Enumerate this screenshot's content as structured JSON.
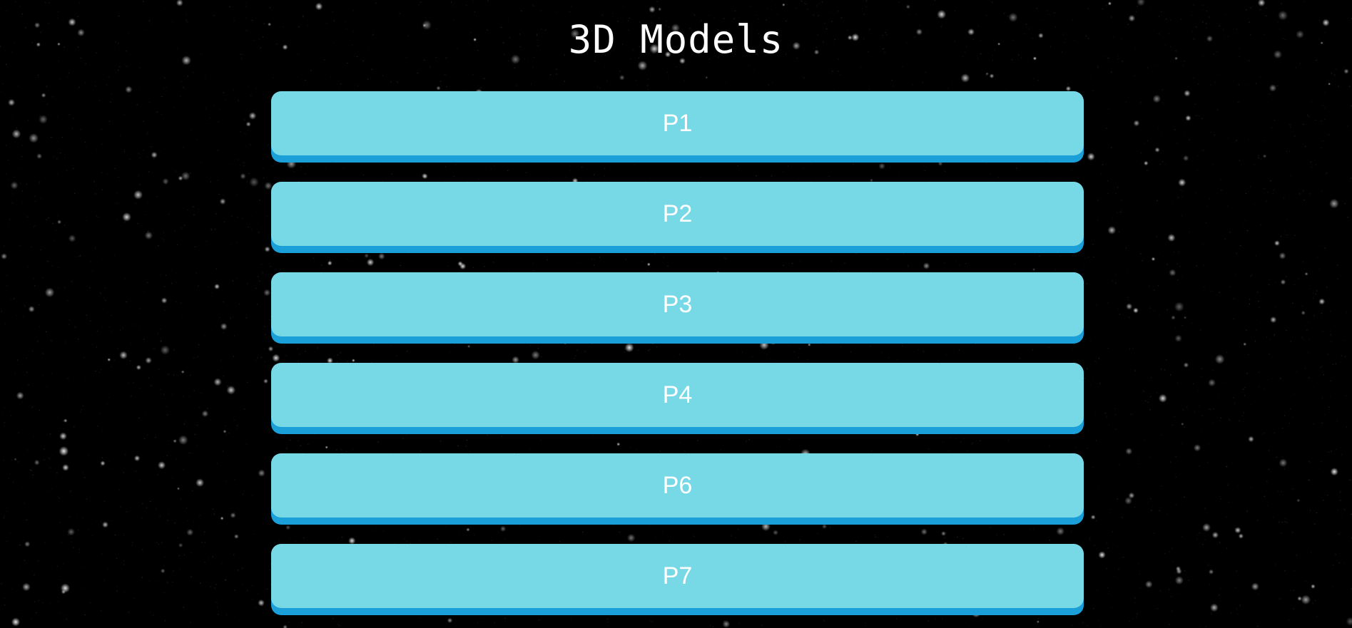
{
  "page": {
    "title": "3D Models"
  },
  "models": [
    {
      "label": "P1"
    },
    {
      "label": "P2"
    },
    {
      "label": "P3"
    },
    {
      "label": "P4"
    },
    {
      "label": "P6"
    },
    {
      "label": "P7"
    }
  ],
  "colors": {
    "background": "#000000",
    "button_face": "#78d9e6",
    "button_shadow": "#1a9fd9",
    "button_text": "#ffffff",
    "title_text": "#ffffff"
  }
}
